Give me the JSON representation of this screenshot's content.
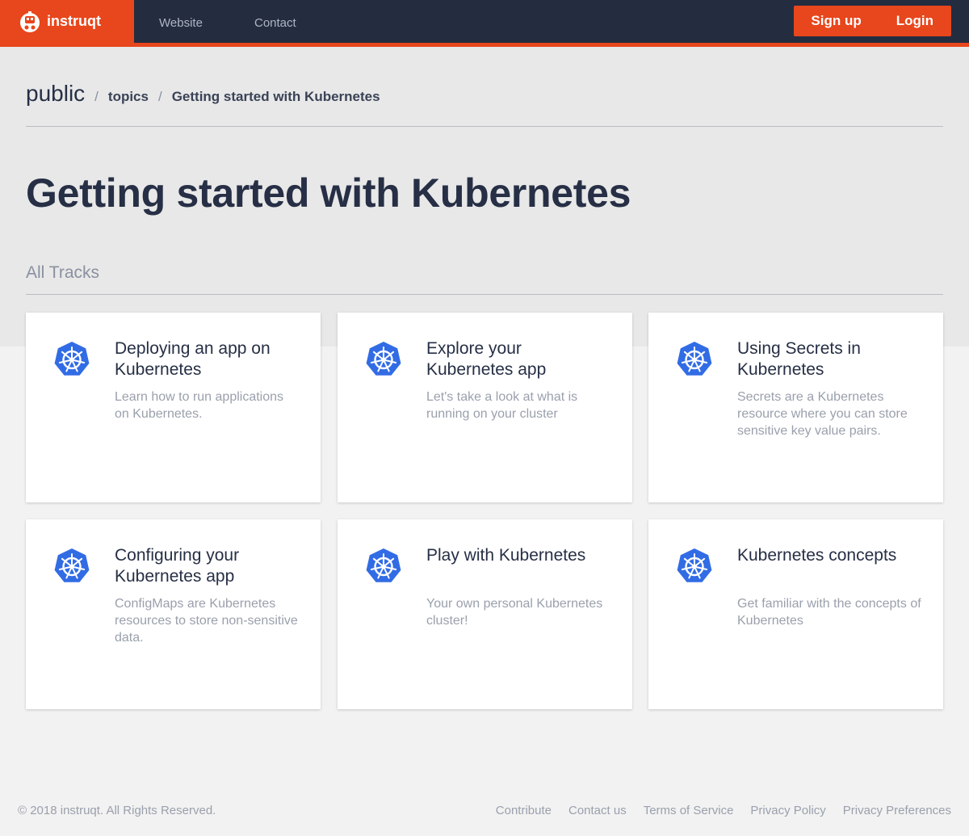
{
  "nav": {
    "brand": "instruqt",
    "links": [
      "Website",
      "Contact"
    ],
    "signup": "Sign up",
    "login": "Login"
  },
  "breadcrumb": {
    "root": "public",
    "separator": "/",
    "items": [
      "topics",
      "Getting started with Kubernetes"
    ]
  },
  "page": {
    "title": "Getting started with Kubernetes",
    "section_label": "All Tracks"
  },
  "tracks": [
    {
      "title": "Deploying an app on Kubernetes",
      "description": "Learn how to run applications on Kubernetes.",
      "icon": "kubernetes-icon"
    },
    {
      "title": "Explore your Kubernetes app",
      "description": "Let's take a look at what is running on your cluster",
      "icon": "kubernetes-icon"
    },
    {
      "title": "Using Secrets in Kubernetes",
      "description": "Secrets are a Kubernetes resource where you can store sensitive key value pairs.",
      "icon": "kubernetes-icon"
    },
    {
      "title": "Configuring your Kubernetes app",
      "description": "ConfigMaps are Kubernetes resources to store non-sensitive data.",
      "icon": "kubernetes-icon"
    },
    {
      "title": "Play with Kubernetes",
      "description": "Your own personal Kubernetes cluster!",
      "icon": "kubernetes-icon"
    },
    {
      "title": "Kubernetes concepts",
      "description": "Get familiar with the concepts of Kubernetes",
      "icon": "kubernetes-icon"
    }
  ],
  "footer": {
    "copyright": "© 2018 instruqt. All Rights Reserved.",
    "links": [
      "Contribute",
      "Contact us",
      "Terms of Service",
      "Privacy Policy",
      "Privacy Preferences"
    ]
  },
  "colors": {
    "accent": "#e8461c",
    "nav_bg": "#242d40",
    "kubernetes_blue": "#326ce5"
  }
}
